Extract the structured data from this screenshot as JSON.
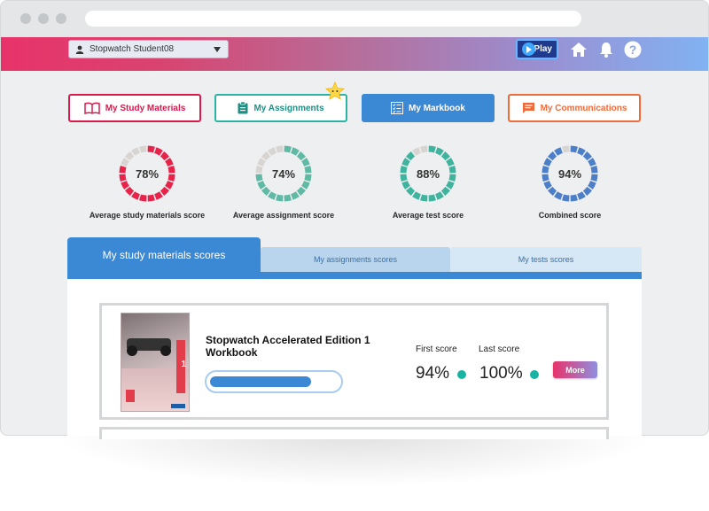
{
  "header": {
    "user_name": "Stopwatch Student08",
    "play_label": "Play",
    "icons": [
      "home-icon",
      "bell-icon",
      "help-icon"
    ]
  },
  "nav": {
    "study_materials": "My Study Materials",
    "assignments": "My Assignments",
    "markbook": "My Markbook",
    "communications": "My Communications"
  },
  "summary": [
    {
      "value": 78,
      "display": "78%",
      "label": "Average study materials score",
      "color": "#e8234a"
    },
    {
      "value": 74,
      "display": "74%",
      "label": "Average assignment score",
      "color": "#5fb9a4"
    },
    {
      "value": 88,
      "display": "88%",
      "label": "Average test score",
      "color": "#3fb39e"
    },
    {
      "value": 94,
      "display": "94%",
      "label": "Combined score",
      "color": "#4d7fc8"
    }
  ],
  "tabs": {
    "study_materials": "My study materials scores",
    "assignments": "My assignments scores",
    "tests": "My tests scores"
  },
  "book": {
    "title": "Stopwatch Accelerated Edition 1 Workbook",
    "progress": 0.8,
    "first_score_label": "First score",
    "first_score": "94%",
    "last_score_label": "Last score",
    "last_score": "100%",
    "more_label": "More"
  },
  "colors": {
    "accent_blue": "#3b88d4",
    "brand_pink": "#e8336a",
    "teal": "#19b3a3",
    "orange": "#ef6b3b"
  }
}
